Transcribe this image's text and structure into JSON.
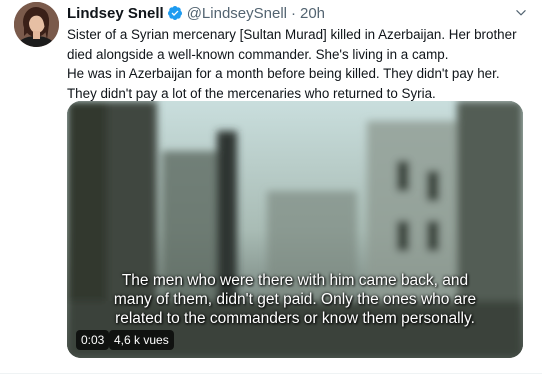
{
  "tweet": {
    "author_name": "Lindsey Snell",
    "handle": "@LindseySnell",
    "separator": "·",
    "time": "20h",
    "text_lines": [
      "Sister of a Syrian mercenary [Sultan Murad] killed in Azerbaijan. Her brother",
      "died alongside a well-known commander. She's living in a camp.",
      "He was in Azerbaijan for a month before being killed. They didn't pay her.",
      "They didn't pay a lot of the mercenaries who returned to Syria."
    ]
  },
  "video": {
    "subtitle_lines": [
      "The men who were there with him came back, and",
      "many of them, didn't get paid. Only the ones who are",
      "related to the commanders or know them personally."
    ],
    "duration": "0:03",
    "views": "4,6 k vues"
  },
  "colors": {
    "verified": "#1d9bf0",
    "secondary_text": "#536471"
  },
  "icons": {
    "verified": "verified-badge-icon",
    "more": "more-options-icon"
  }
}
